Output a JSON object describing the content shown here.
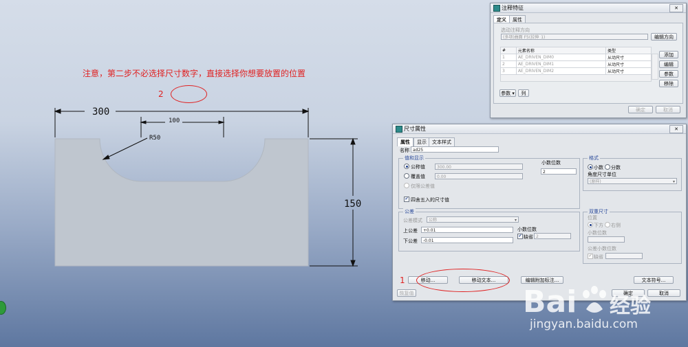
{
  "annotation": {
    "note": "注意，第二步不必选择尺寸数字，直接选择你想要放置的位置",
    "step2": "2",
    "step1": "1"
  },
  "drawing": {
    "dim_300": "300",
    "dim_100": "100",
    "dim_150": "150",
    "dim_r50": "R50"
  },
  "annot_window": {
    "title": "注释特征",
    "close": "✕",
    "tabs": [
      "定义",
      "属性"
    ],
    "direction_label": "选动注释方向",
    "direction_value": "(多项)曲面 F5(拉伸_1)",
    "direction_button": "编辑方向",
    "table_headers": [
      "#",
      "元素名称",
      "类型"
    ],
    "rows": [
      {
        "num": "1",
        "name": "AE_DRIVEN_DIM0",
        "type": "从动尺寸"
      },
      {
        "num": "2",
        "name": "AE_DRIVEN_DIM1",
        "type": "从动尺寸"
      },
      {
        "num": "3",
        "name": "AE_DRIVEN_DIM2",
        "type": "从动尺寸"
      }
    ],
    "side_buttons": [
      "添加",
      "编辑",
      "参数",
      "移除"
    ],
    "param_label": "参数",
    "col_label": "列",
    "ok": "确定",
    "cancel": "取消"
  },
  "dim_window": {
    "title": "尺寸属性",
    "close": "✕",
    "tabs": [
      "属性",
      "显示",
      "文本样式"
    ],
    "name_label": "名称",
    "name_value": "ad25",
    "value_group": "值和显示",
    "nominal_label": "公称值",
    "nominal_value": "300.00",
    "override_label": "覆盖值",
    "override_value": "0.00",
    "only_tol_label": "仅限公差值",
    "decimals_label": "小数位数",
    "decimals_value": "2",
    "round_label": "四舍五入的尺寸值",
    "format_group": "格式",
    "decimal_label": "小数",
    "fraction_label": "分数",
    "angle_unit_label": "角度尺寸单位",
    "angle_unit_value": "(原样)",
    "tol_group": "公差",
    "tol_mode_label": "公差模式",
    "tol_mode_value": "公称",
    "upper_label": "上公差",
    "upper_value": "+0.01",
    "lower_label": "下公差",
    "lower_value": "-0.01",
    "tol_decimals_label": "小数位数",
    "default_label": "缺省",
    "tol_decimals_value": "2",
    "dual_group": "双重尺寸",
    "position_label": "位置",
    "below_label": "下方",
    "right_label": "右侧",
    "dual_decimals_label": "小数位数",
    "dual_tol_decimals_label": "公差小数位数",
    "dual_default_label": "缺省",
    "btn_move": "移动...",
    "btn_move_text": "移动文本...",
    "btn_edit_attach": "编辑附加标注...",
    "btn_text_symbol": "文本符号...",
    "btn_restore": "恢复值",
    "btn_ok": "确定",
    "btn_cancel": "取消"
  },
  "watermark": {
    "brand": "Bai",
    "brand2": "经验",
    "url": "jingyan.baidu.com"
  }
}
